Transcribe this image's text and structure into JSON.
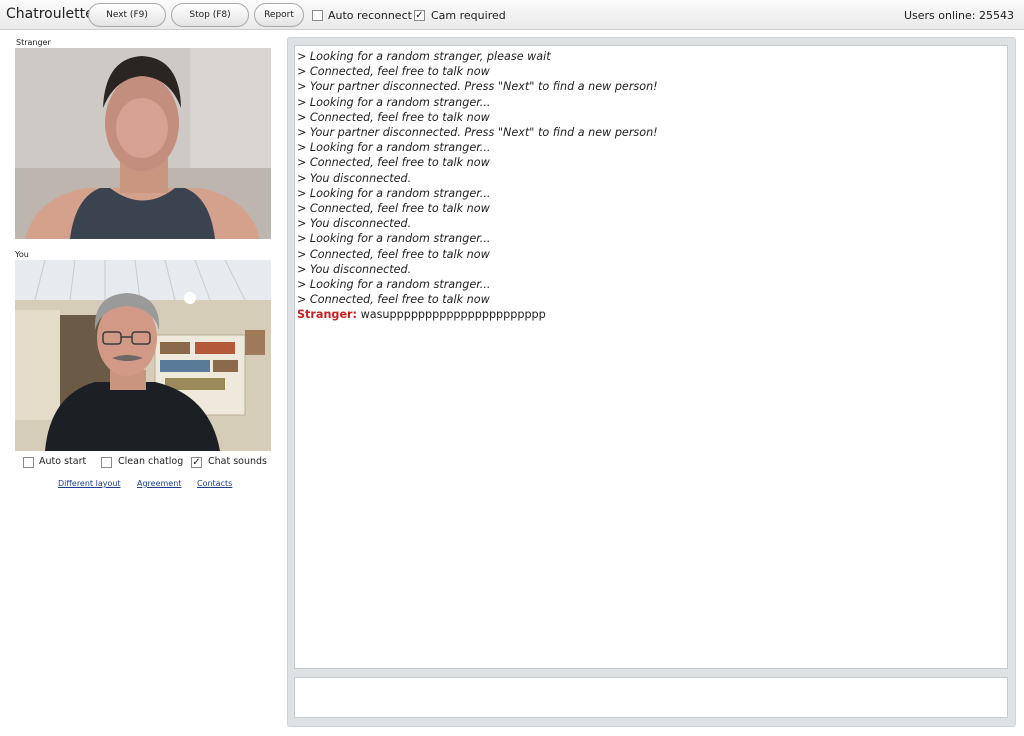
{
  "header": {
    "title": "Chatroulette",
    "next_label": "Next (F9)",
    "stop_label": "Stop (F8)",
    "report_label": "Report",
    "auto_reconnect_label": "Auto reconnect",
    "auto_reconnect_checked": false,
    "cam_required_label": "Cam required",
    "cam_required_checked": true,
    "users_online": "Users online: 25543"
  },
  "stranger_video": {
    "label": "Stranger"
  },
  "you_video": {
    "label": "You"
  },
  "options": {
    "auto_start_label": "Auto start",
    "auto_start_checked": false,
    "clean_chatlog_label": "Clean chatlog",
    "clean_chatlog_checked": false,
    "chat_sounds_label": "Chat sounds",
    "chat_sounds_checked": true
  },
  "links": {
    "different_layout": "Different layout",
    "agreement": "Agreement",
    "contacts": "Contacts"
  },
  "chat": {
    "system_lines": [
      "> Looking for a random stranger, please wait",
      "> Connected, feel free to talk now",
      "> Your partner disconnected. Press \"Next\" to find a new person!",
      "> Looking for a random stranger...",
      "> Connected, feel free to talk now",
      "> Your partner disconnected. Press \"Next\" to find a new person!",
      "> Looking for a random stranger...",
      "> Connected, feel free to talk now",
      "> You disconnected.",
      "> Looking for a random stranger...",
      "> Connected, feel free to talk now",
      "> You disconnected.",
      "> Looking for a random stranger...",
      "> Connected, feel free to talk now",
      "> You disconnected.",
      "> Looking for a random stranger...",
      "> Connected, feel free to talk now"
    ],
    "message": {
      "sender": "Stranger:",
      "text": "wasupppppppppppppppppppppp"
    },
    "input_value": ""
  },
  "colors": {
    "stranger_name": "#cc1f1f",
    "link": "#1a3f8f",
    "chat_frame": "#dfe2e5"
  }
}
